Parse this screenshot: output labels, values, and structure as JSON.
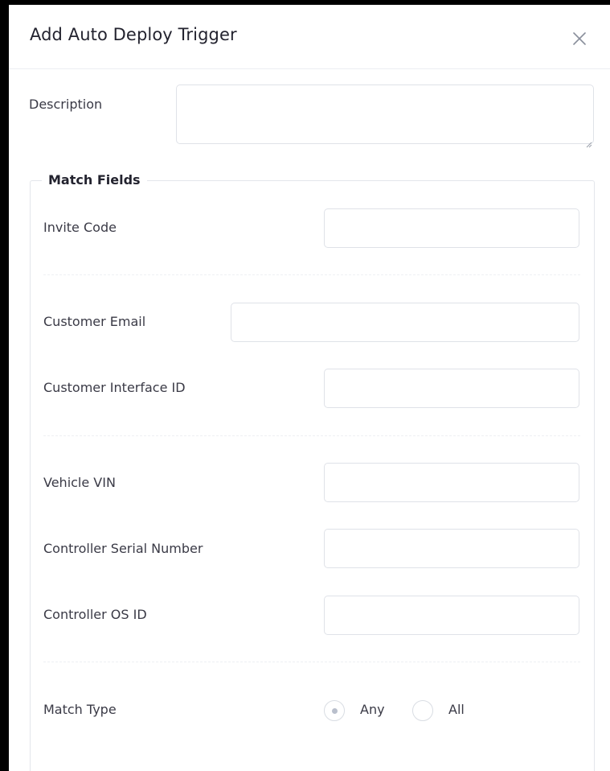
{
  "dialog": {
    "title": "Add Auto Deploy Trigger"
  },
  "description": {
    "label": "Description",
    "value": ""
  },
  "match_fields": {
    "legend": "Match Fields",
    "invite_code": {
      "label": "Invite Code",
      "value": ""
    },
    "customer_email": {
      "label": "Customer Email",
      "value": ""
    },
    "customer_interface_id": {
      "label": "Customer Interface ID",
      "value": ""
    },
    "vehicle_vin": {
      "label": "Vehicle VIN",
      "value": ""
    },
    "controller_serial_number": {
      "label": "Controller Serial Number",
      "value": ""
    },
    "controller_os_id": {
      "label": "Controller OS ID",
      "value": ""
    }
  },
  "match_type": {
    "label": "Match Type",
    "options": [
      {
        "label": "Any",
        "selected": true
      },
      {
        "label": "All",
        "selected": false
      }
    ]
  },
  "icons": {
    "close": "close-icon"
  },
  "colors": {
    "border": "#dfe2e8",
    "text": "#3a3a46",
    "title": "#23232f",
    "radio_dot": "#b9bfcc"
  }
}
